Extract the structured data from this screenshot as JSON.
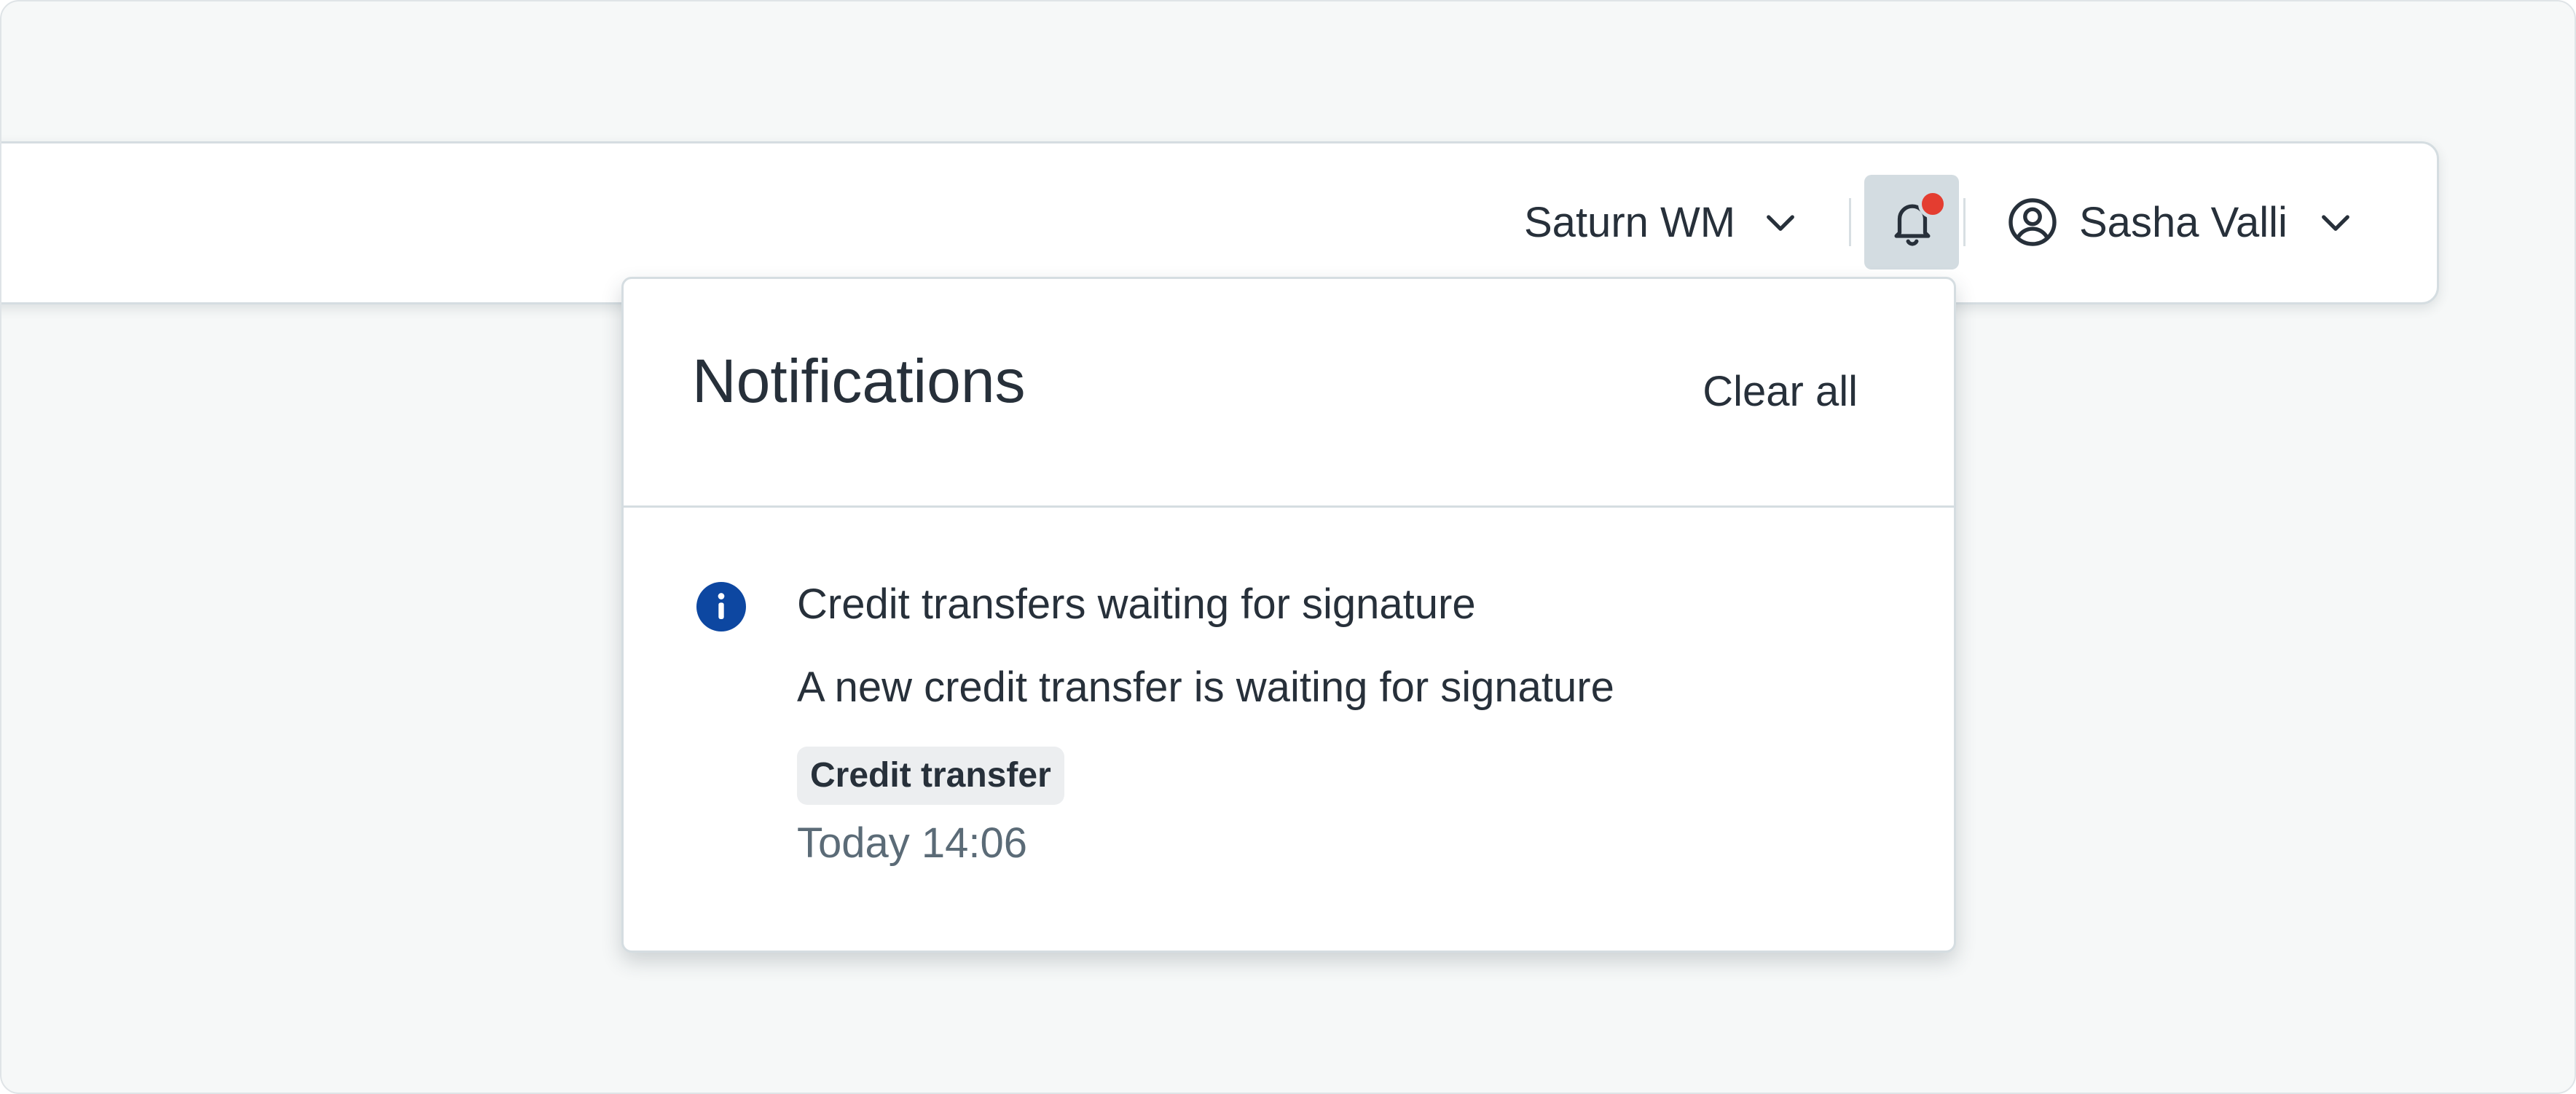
{
  "header": {
    "workspace": {
      "label": "Saturn WM",
      "icon": "chevron-down-icon"
    },
    "notifications_button": {
      "icon": "bell-icon",
      "has_unread": true,
      "badge_color": "#e43d30"
    },
    "user": {
      "icon": "user-circle-icon",
      "name": "Sasha Valli",
      "menu_icon": "chevron-down-icon"
    }
  },
  "notifications_panel": {
    "title": "Notifications",
    "clear_all_label": "Clear all",
    "items": [
      {
        "icon": "info-icon",
        "icon_color": "#0d47a1",
        "title": "Credit transfers waiting for signature",
        "body": "A new credit transfer is waiting for signature",
        "tag": "Credit transfer",
        "time": "Today 14:06"
      }
    ]
  },
  "colors": {
    "background": "#f6f8f8",
    "text": "#27303a",
    "muted_text": "#5b6b77",
    "border": "#d5dde1",
    "active_button_bg": "#d3dce1"
  }
}
